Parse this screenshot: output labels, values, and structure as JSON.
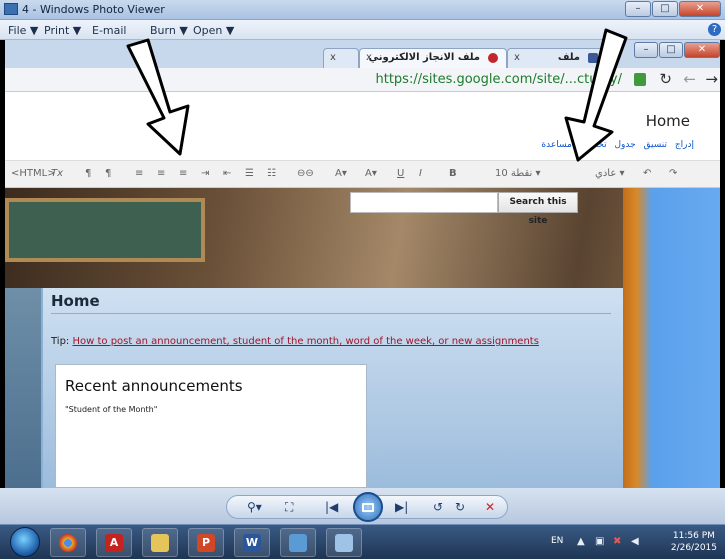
{
  "window": {
    "title": "4 - Windows Photo Viewer",
    "minimize": "–",
    "maximize": "□",
    "close": "✕"
  },
  "menubar": {
    "file": "File ▼",
    "print": "Print ▼",
    "email": "E-mail",
    "burn": "Burn ▼",
    "open": "Open ▼",
    "help": "?"
  },
  "browser": {
    "tab_active_title": "ملف الانجاز الالكتروني",
    "tab_close": "x",
    "tab_second_title": "ملف",
    "url": "https://sites.google.com/site/...cturky/",
    "reload": "↻",
    "back": "←",
    "forward": "→"
  },
  "page": {
    "site_title": "Home",
    "menu_links": "إدراج تنسيق جدول تخطيط مساعدة",
    "toolbar": {
      "html": "<HTML>",
      "clear_format": "Tx",
      "font_size": "10 نقطة ▾",
      "font_family": "عادي ▾",
      "bold": "B",
      "italic": "I",
      "underline": "U",
      "text_color": "A▾",
      "bg_color": "A▾",
      "link": "⊖⊖",
      "undo": "↶",
      "redo": "↷"
    },
    "search_button": "Search this site",
    "heading": "Home",
    "tip_label": "Tip:",
    "tip_link": "How to post an announcement, student of the month, word of the week, or new assignments",
    "announcements_title": "Recent announcements",
    "announcement_item": "\"Student of the Month\""
  },
  "controls": {
    "zoom": "⚲▾",
    "fit": "⛶",
    "prev": "|◀",
    "next": "▶|",
    "rotate_ccw": "↺",
    "rotate_cw": "↻",
    "delete": "✕"
  },
  "taskbar": {
    "lang": "EN",
    "time": "11:56 PM",
    "date": "2/26/2015",
    "apps": [
      "chrome",
      "acrobat",
      "explorer",
      "powerpoint",
      "word",
      "photo-viewer",
      "paint"
    ]
  },
  "colors": {
    "accent": "#2e6ac2",
    "url_green": "#1b7c2b",
    "tip_link": "#a0152a",
    "arrow": "#000000"
  }
}
